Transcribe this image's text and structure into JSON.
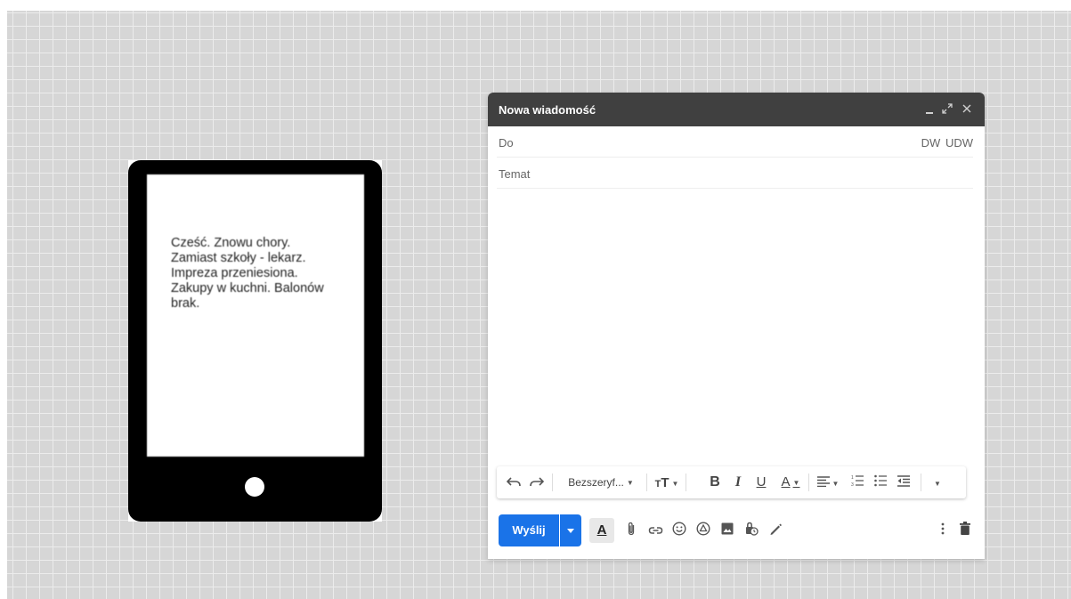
{
  "tablet": {
    "message": "Cześć. Znowu chory.\nZamiast szkoły - lekarz.\nImpreza przeniesiona.\nZakupy w kuchni. Balonów\nbrak."
  },
  "compose": {
    "title": "Nowa wiadomość",
    "to_label": "Do",
    "cc_label": "DW",
    "bcc_label": "UDW",
    "subject_placeholder": "Temat",
    "body_value": "",
    "send_label": "Wyślij"
  },
  "format_toolbar": {
    "font_name": "Bezszeryf...",
    "icons": [
      "undo-icon",
      "redo-icon",
      "font-size-icon",
      "bold-icon",
      "italic-icon",
      "underline-icon",
      "text-color-icon",
      "align-icon",
      "numbered-list-icon",
      "bulleted-list-icon",
      "indent-less-icon",
      "more-formatting-icon"
    ]
  },
  "bottom_toolbar": {
    "icons": [
      "formatting-options-icon",
      "attach-icon",
      "link-icon",
      "emoji-icon",
      "drive-icon",
      "photo-icon",
      "confidential-icon",
      "signature-icon",
      "more-options-icon",
      "discard-icon"
    ]
  },
  "colors": {
    "header_bg": "#404040",
    "send_button": "#1a73e8",
    "tablet_body": "#000000",
    "canvas_bg": "#d6d6d6"
  }
}
